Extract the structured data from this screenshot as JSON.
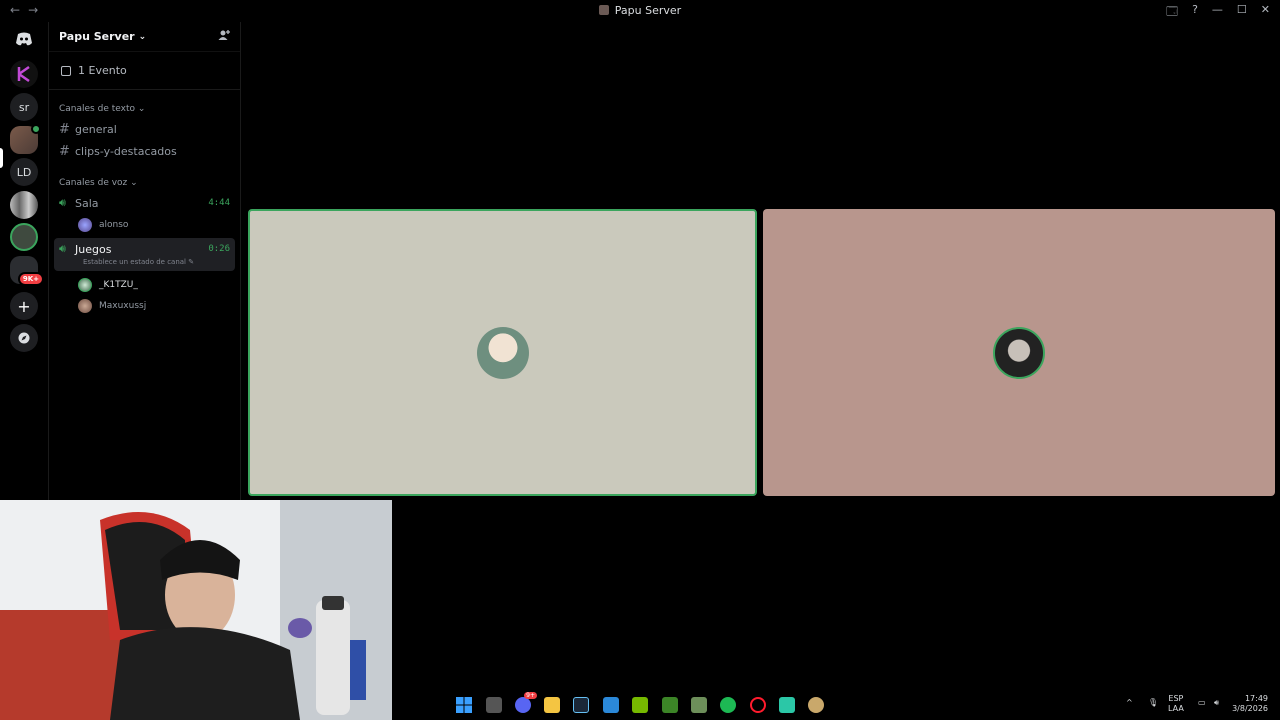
{
  "window": {
    "title": "Papu Server",
    "nav_back": "←",
    "nav_forward": "→",
    "controls": [
      "🗔",
      "?",
      "—",
      "☐",
      "✕"
    ]
  },
  "servers": [
    {
      "name": "discord-home",
      "label": ""
    },
    {
      "name": "server-k",
      "label": ""
    },
    {
      "name": "server-sr",
      "label": "sr"
    },
    {
      "name": "server-papu",
      "label": ""
    },
    {
      "name": "server-ld",
      "label": "LD"
    },
    {
      "name": "server-building",
      "label": ""
    },
    {
      "name": "server-avatar",
      "label": ""
    },
    {
      "name": "server-folder",
      "label": "9K+"
    }
  ],
  "sidebar": {
    "server_name": "Papu Server",
    "event_label": "1 Evento",
    "text_category": "Canales de texto",
    "text_channels": [
      "general",
      "clips-y-destacados"
    ],
    "voice_category": "Canales de voz",
    "voice_channels": [
      {
        "name": "Sala",
        "time": "4:44",
        "members": [
          "alonso"
        ]
      },
      {
        "name": "Juegos",
        "time": "0:26",
        "status": "Establece un estado de canal",
        "members": [
          "_K1TZU_",
          "Maxuxussj"
        ]
      }
    ]
  },
  "taskbar": {
    "language": "ESP",
    "layout": "LAA",
    "time": "17:49",
    "date": "3/8/2026",
    "discord_badge": "9+"
  },
  "colors": {
    "tile_left_bg": "#cac9bc",
    "tile_left_border": "#3ba55d",
    "tile_right_bg": "#b8968d",
    "voice_green": "#3ba55d"
  }
}
